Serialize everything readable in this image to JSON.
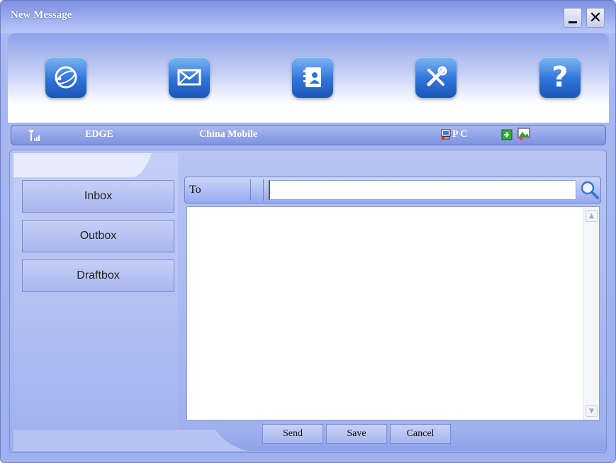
{
  "window": {
    "title": "New Message"
  },
  "titlebar_controls": {
    "minimize_icon": "minimize-icon",
    "close_icon": "close-icon",
    "close_glyph": "✕"
  },
  "toolbar": {
    "icons": [
      "internet-globe-icon",
      "envelope-icon",
      "contacts-book-icon",
      "tools-icon",
      "help-icon"
    ],
    "help_glyph": "?"
  },
  "status": {
    "signal_icon": "signal-strength-icon",
    "network": "EDGE",
    "operator": "China Mobile",
    "pc_label": "P C",
    "pc_icon": "pc-connection-icon",
    "right_icons": [
      "sim-icon",
      "picture-icon"
    ]
  },
  "sidebar": {
    "items": [
      {
        "label": "Inbox"
      },
      {
        "label": "Outbox"
      },
      {
        "label": "Draftbox"
      }
    ]
  },
  "compose": {
    "to_label": "To",
    "to_value": "",
    "body_text": "",
    "search_icon": "search-icon"
  },
  "actions": {
    "send": "Send",
    "save": "Save",
    "cancel": "Cancel"
  }
}
